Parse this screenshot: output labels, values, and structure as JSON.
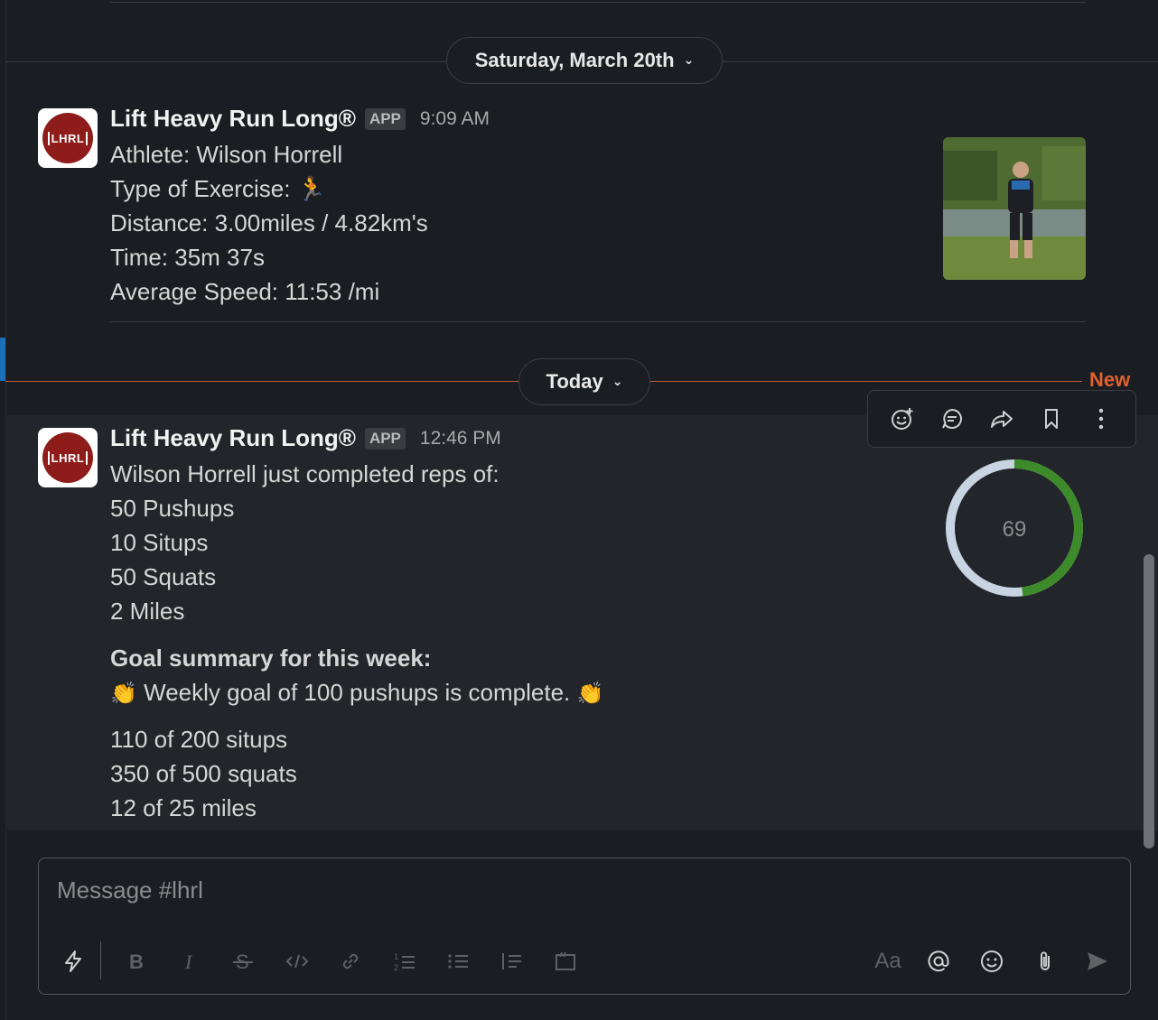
{
  "date_dividers": {
    "previous": "Saturday, March 20th",
    "today": "Today",
    "new_label": "New"
  },
  "message1": {
    "sender": "Lift Heavy Run Long®",
    "badge": "APP",
    "time": "9:09 AM",
    "avatar_text": "LHRL",
    "lines": [
      "Athlete: Wilson  Horrell",
      "Type of Exercise: 🏃",
      "Distance: 3.00miles / 4.82km's",
      "Time: 35m 37s",
      "Average Speed: 11:53 /mi"
    ]
  },
  "message2": {
    "sender": "Lift Heavy Run Long®",
    "badge": "APP",
    "time": "12:46 PM",
    "avatar_text": "LHRL",
    "lines": [
      "Wilson Horrell just completed reps of:",
      "50 Pushups",
      "10 Situps",
      "50 Squats",
      "2 Miles"
    ],
    "goal_title": "Goal summary for this week:",
    "goal_complete": "Weekly goal of 100 pushups is complete.",
    "clap_emoji": "👏",
    "goal_lines": [
      "110 of 200 situps",
      "350 of 500 squats",
      "12 of 25 miles"
    ],
    "progress": {
      "value_label": "69",
      "fraction": 0.48,
      "track_color": "#c9d4e3",
      "fill_color": "#3d8a2a"
    }
  },
  "toolbar_icons": [
    "add-reaction-icon",
    "reply-thread-icon",
    "share-icon",
    "bookmark-icon",
    "more-actions-icon"
  ],
  "composer": {
    "placeholder": "Message #lhrl",
    "format_icons": [
      "shortcuts-icon",
      "bold-icon",
      "italic-icon",
      "strikethrough-icon",
      "code-icon",
      "link-icon",
      "ordered-list-icon",
      "bulleted-list-icon",
      "blockquote-icon",
      "code-block-icon",
      "text-format-icon",
      "mention-icon",
      "emoji-icon",
      "attach-icon",
      "send-icon"
    ],
    "text_format_label": "Aa"
  },
  "colors": {
    "background": "#1a1d21",
    "new_divider": "#e0602f",
    "accent": "#1d6fb8"
  }
}
